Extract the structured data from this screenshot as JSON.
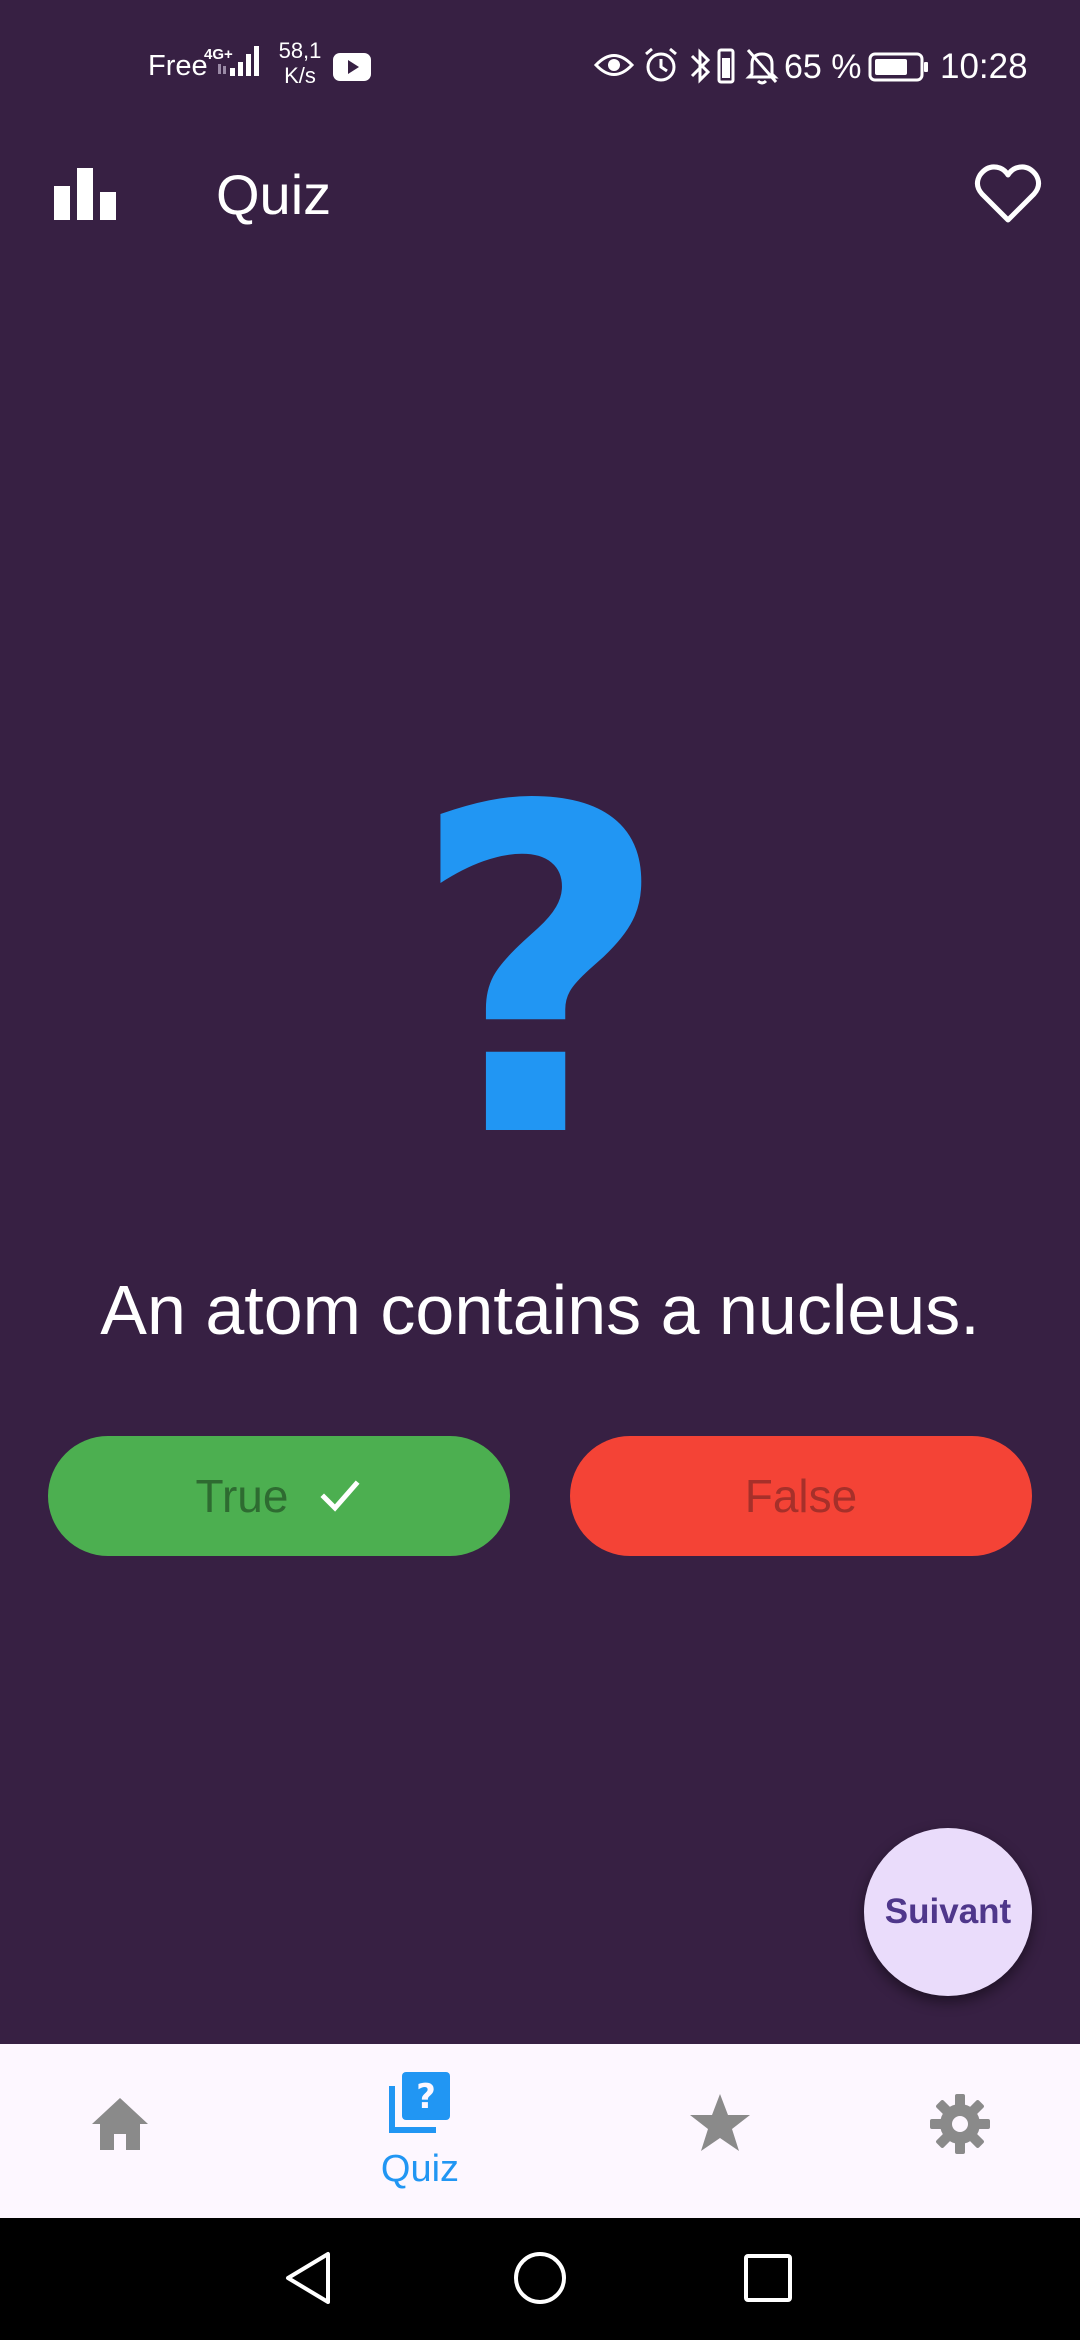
{
  "status_bar": {
    "carrier": "Free",
    "network": "4G+",
    "speed_value": "58,1",
    "speed_unit": "K/s",
    "battery_percent": "65 %",
    "time": "10:28"
  },
  "app_bar": {
    "title": "Quiz"
  },
  "quiz": {
    "symbol": "?",
    "question": "An atom contains a nucleus.",
    "true_label": "True",
    "false_label": "False"
  },
  "fab": {
    "label": "Suivant"
  },
  "bottom_nav": {
    "items": [
      {
        "icon": "home-icon"
      },
      {
        "icon": "quiz-icon",
        "label": "Quiz"
      },
      {
        "icon": "star-icon"
      },
      {
        "icon": "gear-icon"
      }
    ],
    "active_color": "#2196f3",
    "inactive_color": "#8a8a8a"
  },
  "colors": {
    "background": "#372043",
    "accent": "#2196f3",
    "true_button": "#4caf50",
    "false_button": "#f44336",
    "fab": "#eadcfb"
  }
}
